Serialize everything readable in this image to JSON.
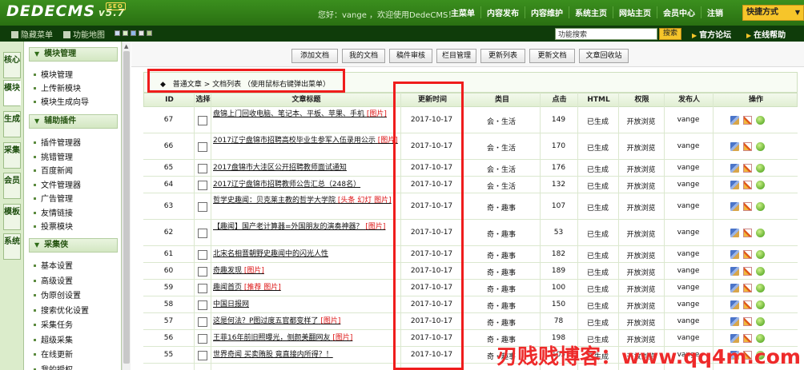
{
  "header": {
    "logo": "DEDECMS",
    "version": "v5.7",
    "badge": "SEO",
    "welcome": "您好：vange ，欢迎使用DedeCMS！",
    "nav": [
      "主菜单",
      "内容发布",
      "内容维护",
      "系统主页",
      "网站主页",
      "会员中心",
      "注销"
    ],
    "quick": "快捷方式"
  },
  "subbar": {
    "hide_menu": "隐藏菜单",
    "feature_map": "功能地图",
    "colors": [
      "#c9d9f2",
      "#d7efc1",
      "#8fb9e9",
      "#e6e6e6",
      "#b5d38e"
    ],
    "search_value": "功能搜索",
    "search_button": "搜索",
    "forum": "官方论坛",
    "help": "在线帮助"
  },
  "vtabs": [
    "核心",
    "模块",
    "生成",
    "采集",
    "会员",
    "模板",
    "系统"
  ],
  "sidebar": {
    "sections": [
      {
        "title": "模块管理",
        "items": [
          "模块管理",
          "上传新模块",
          "模块生成向导"
        ]
      },
      {
        "title": "辅助插件",
        "items": [
          "插件管理器",
          "挑错管理",
          "百度新闻",
          "文件管理器",
          "广告管理",
          "友情链接",
          "投票模块"
        ]
      },
      {
        "title": "采集侠",
        "items": [
          "基本设置",
          "高级设置",
          "伪原创设置",
          "搜索优化设置",
          "采集任务",
          "超级采集",
          "在线更新",
          "我的授权"
        ]
      }
    ]
  },
  "toolbar": [
    "添加文档",
    "我的文档",
    "稿件审核",
    "栏目管理",
    "更新列表",
    "更新文档",
    "文章回收站"
  ],
  "breadcrumb": {
    "part1": "普通文章",
    "sep": ">",
    "part2": "文档列表",
    "hint": "（使用鼠标右键弹出菜单）"
  },
  "table": {
    "columns": [
      "ID",
      "选择",
      "文章标题",
      "更新时间",
      "类目",
      "点击",
      "HTML",
      "权限",
      "发布人",
      "操作"
    ],
    "rows": [
      {
        "id": "67",
        "title": "盘锦上门回收电脑、笔记本、平板、苹果、手机",
        "tag": "[图片]",
        "date": "2017-10-17",
        "cat": "会・生活",
        "hits": "149",
        "html": "已生成",
        "perm": "开放浏览",
        "author": "vange"
      },
      {
        "id": "66",
        "title": "2017辽宁盘锦市招聘高校毕业生参军入伍录用公示",
        "tag": "[图片]",
        "date": "2017-10-17",
        "cat": "会・生活",
        "hits": "170",
        "html": "已生成",
        "perm": "开放浏览",
        "author": "vange"
      },
      {
        "id": "65",
        "title": "2017盘锦市大洼区公开招聘教师面试通知",
        "tag": "",
        "date": "2017-10-17",
        "cat": "会・生活",
        "hits": "176",
        "html": "已生成",
        "perm": "开放浏览",
        "author": "vange"
      },
      {
        "id": "64",
        "title": "2017辽宁盘锦市招聘教师公告汇总（248名）",
        "tag": "",
        "date": "2017-10-17",
        "cat": "会・生活",
        "hits": "132",
        "html": "已生成",
        "perm": "开放浏览",
        "author": "vange"
      },
      {
        "id": "63",
        "title": "哲学史趣闻：贝克莱主教的哲学大学院",
        "tag": "[头条 幻灯 图片]",
        "date": "2017-10-17",
        "cat": "奇・趣事",
        "hits": "107",
        "html": "已生成",
        "perm": "开放浏览",
        "author": "vange"
      },
      {
        "id": "62",
        "title": "【趣闻】国产老计算器=外国朋友的演奏神器？",
        "tag": "[图片]",
        "date": "2017-10-17",
        "cat": "奇・趣事",
        "hits": "53",
        "html": "已生成",
        "perm": "开放浏览",
        "author": "vange"
      },
      {
        "id": "61",
        "title": "北宋名相晋朝野史趣闻中的闪光人性",
        "tag": "",
        "date": "2017-10-17",
        "cat": "奇・趣事",
        "hits": "182",
        "html": "已生成",
        "perm": "开放浏览",
        "author": "vange"
      },
      {
        "id": "60",
        "title": "奇趣发现",
        "tag": "[图片]",
        "date": "2017-10-17",
        "cat": "奇・趣事",
        "hits": "189",
        "html": "已生成",
        "perm": "开放浏览",
        "author": "vange"
      },
      {
        "id": "59",
        "title": "趣闻首页",
        "tag": "[推荐 图片]",
        "date": "2017-10-17",
        "cat": "奇・趣事",
        "hits": "100",
        "html": "已生成",
        "perm": "开放浏览",
        "author": "vange"
      },
      {
        "id": "58",
        "title": "中国日报网",
        "tag": "",
        "date": "2017-10-17",
        "cat": "奇・趣事",
        "hits": "150",
        "html": "已生成",
        "perm": "开放浏览",
        "author": "vange"
      },
      {
        "id": "57",
        "title": "这是何法？P图过度五官都变样了",
        "tag": "[图片]",
        "date": "2017-10-17",
        "cat": "奇・趣事",
        "hits": "78",
        "html": "已生成",
        "perm": "开放浏览",
        "author": "vange"
      },
      {
        "id": "56",
        "title": "王菲16年前旧照曝光，侧颜美翻网友",
        "tag": "[图片]",
        "date": "2017-10-17",
        "cat": "奇・趣事",
        "hits": "198",
        "html": "已生成",
        "perm": "开放浏览",
        "author": "vange"
      },
      {
        "id": "55",
        "title": "世界奇闻 买卖贿股 竟直接内所得？！",
        "tag": "",
        "date": "2017-10-17",
        "cat": "奇・趣事",
        "hits": "105",
        "html": "已生成",
        "perm": "开放浏览",
        "author": "vange"
      }
    ]
  },
  "watermark": {
    "name": "刃贱贱博客：",
    "url": "www.qq4m.com"
  }
}
